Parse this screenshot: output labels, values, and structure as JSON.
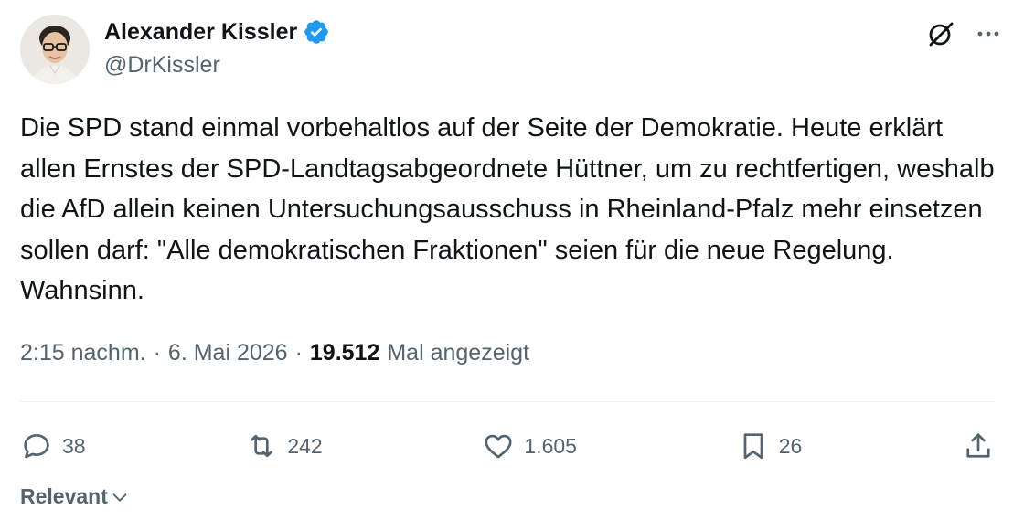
{
  "author": {
    "display_name": "Alexander Kissler",
    "handle": "@DrKissler",
    "verified": true,
    "verified_color": "#1d9bf0",
    "avatar_icon": "profile-photo"
  },
  "header_actions": {
    "grok_icon": "grok-icon",
    "more_icon": "more-icon"
  },
  "tweet": {
    "text": "Die SPD stand einmal vorbehaltlos auf der Seite der Demokratie. Heute erklärt allen Ernstes der SPD-Landtagsabgeordnete Hüttner, um zu rechtfertigen, weshalb die AfD allein keinen Untersuchungsausschuss in Rheinland-Pfalz mehr einsetzen sollen darf: \"Alle demokratischen Fraktionen\" seien für die neue Regelung. Wahnsinn."
  },
  "meta": {
    "time": "2:15 nachm.",
    "separator": "·",
    "date": "6. Mai 2026",
    "views_count": "19.512",
    "views_label": "Mal angezeigt"
  },
  "actions": {
    "replies": "38",
    "reposts": "242",
    "likes": "1.605",
    "bookmarks": "26"
  },
  "sort": {
    "label": "Relevant"
  },
  "colors": {
    "text_primary": "#0f1419",
    "text_secondary": "#536471",
    "divider": "#eff3f4"
  }
}
